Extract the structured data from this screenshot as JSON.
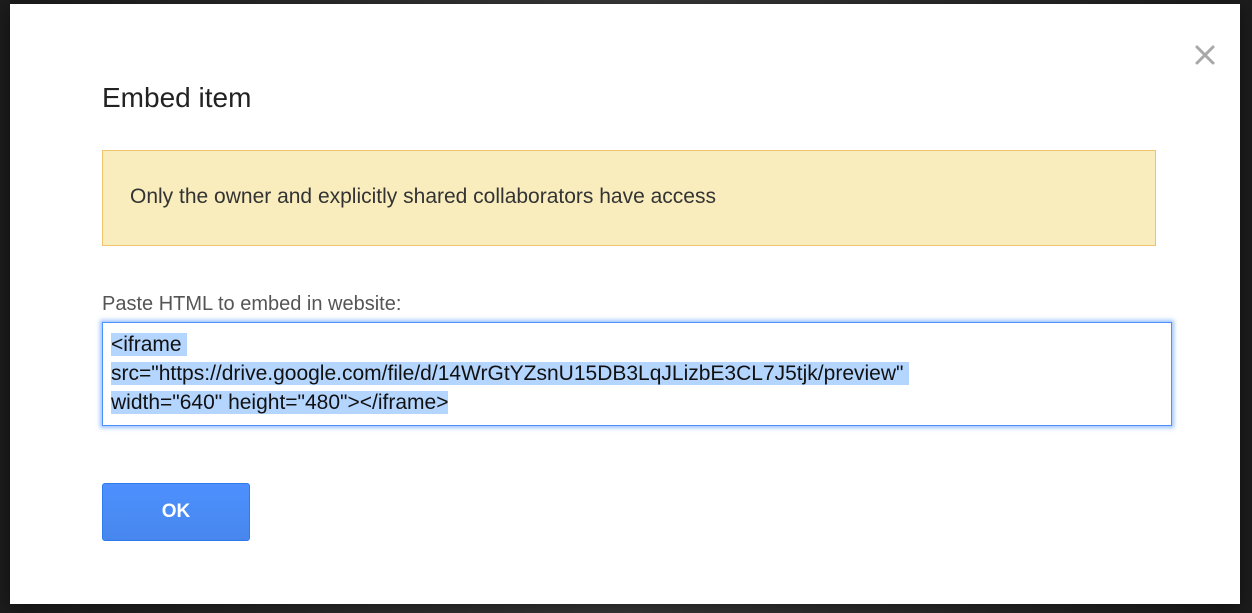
{
  "dialog": {
    "title": "Embed item",
    "close_icon": "close-icon",
    "notice": {
      "text": "Only the owner and explicitly shared collaborators have access",
      "background": "#f9edbe",
      "border": "#f0c36d"
    },
    "embed": {
      "label": "Paste HTML to embed in website:",
      "line1": "<iframe ",
      "line2": "src=\"https://drive.google.com/file/d/14WrGtYZsnU15DB3LqJLizbE3CL7J5tjk/preview\" ",
      "line3": "width=\"640\" height=\"480\"></iframe>",
      "selected": true
    },
    "ok_label": "OK",
    "accent": "#4d90fe"
  }
}
